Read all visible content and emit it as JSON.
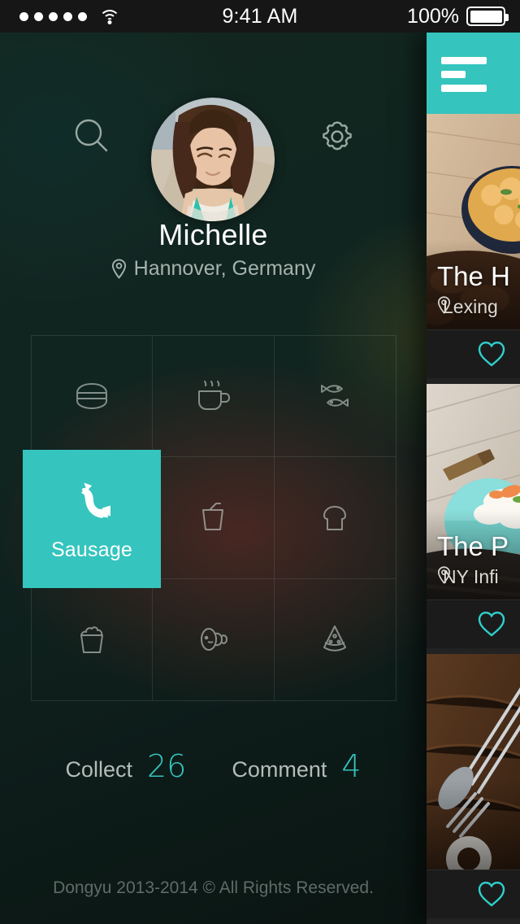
{
  "statusbar": {
    "signal_dots": 5,
    "wifi_icon": "wifi-icon",
    "time": "9:41 AM",
    "battery_percent": "100%",
    "battery_icon": "battery-full-icon"
  },
  "profile": {
    "search_icon": "search-icon",
    "settings_icon": "gear-icon",
    "avatar": "user-avatar",
    "name": "Michelle",
    "location_icon": "map-pin-icon",
    "location": "Hannover, Germany"
  },
  "categories": [
    {
      "id": "burger",
      "icon": "burger-icon",
      "label": "Burger",
      "selected": false
    },
    {
      "id": "coffee",
      "icon": "coffee-icon",
      "label": "Coffee",
      "selected": false
    },
    {
      "id": "fish",
      "icon": "fish-icon",
      "label": "Fish",
      "selected": false
    },
    {
      "id": "sausage",
      "icon": "sausage-icon",
      "label": "Sausage",
      "selected": true
    },
    {
      "id": "drink",
      "icon": "drink-icon",
      "label": "Drink",
      "selected": false
    },
    {
      "id": "bread",
      "icon": "bread-icon",
      "label": "Bread",
      "selected": false
    },
    {
      "id": "popcorn",
      "icon": "popcorn-icon",
      "label": "Popcorn",
      "selected": false
    },
    {
      "id": "ham",
      "icon": "ham-icon",
      "label": "Ham",
      "selected": false
    },
    {
      "id": "pizza",
      "icon": "pizza-icon",
      "label": "Pizza",
      "selected": false
    }
  ],
  "selected_tile": {
    "label": "Sausage",
    "icon": "sausage-icon"
  },
  "stats": [
    {
      "key": "Collect",
      "value": "26"
    },
    {
      "key": "Comment",
      "value": "4"
    }
  ],
  "footer": {
    "text": "Dongyu 2013-2014 © All Rights Reserved."
  },
  "drawer": {
    "menu_icon": "hamburger-menu-icon",
    "cards": [
      {
        "title": "The H",
        "location_icon": "map-pin-icon",
        "location": "Lexing",
        "like_icon": "heart-outline-icon"
      },
      {
        "title": "The P",
        "location_icon": "map-pin-icon",
        "location": "NY Infi",
        "like_icon": "heart-outline-icon"
      },
      {
        "title": "",
        "location_icon": "map-pin-icon",
        "location": "",
        "like_icon": "heart-outline-icon"
      }
    ]
  },
  "colors": {
    "accent_teal": "#35c4be",
    "background_dark": "#11231e",
    "statusbar": "#161616",
    "text_primary": "#ffffff",
    "text_muted": "#a7b2ad"
  }
}
